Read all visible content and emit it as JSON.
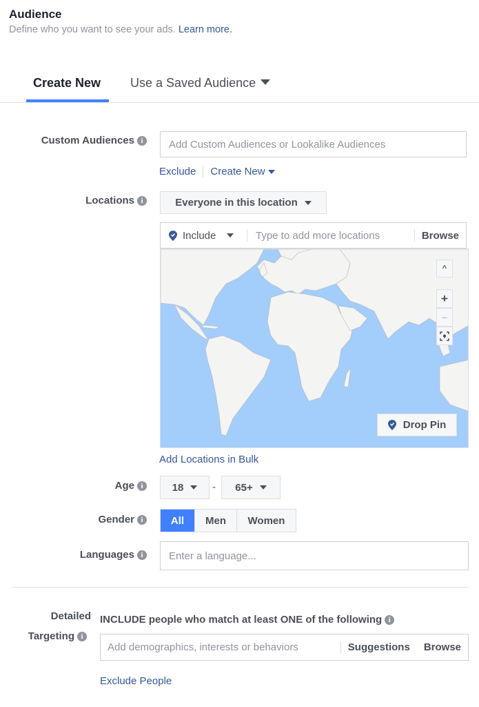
{
  "header": {
    "title": "Audience",
    "subtitle": "Define who you want to see your ads.",
    "learn_more": "Learn more."
  },
  "tabs": [
    {
      "label": "Create New",
      "active": true
    },
    {
      "label": "Use a Saved Audience",
      "active": false
    }
  ],
  "custom_audiences": {
    "label": "Custom Audiences",
    "placeholder": "Add Custom Audiences or Lookalike Audiences",
    "exclude_link": "Exclude",
    "create_new_link": "Create New"
  },
  "locations": {
    "label": "Locations",
    "dropdown_value": "Everyone in this location",
    "include_value": "Include",
    "placeholder": "Type to add more locations",
    "browse_label": "Browse",
    "map_controls": {
      "up": "^",
      "zoom_in": "+",
      "zoom_out": "−"
    },
    "drop_pin_label": "Drop Pin",
    "bulk_link": "Add Locations in Bulk"
  },
  "age": {
    "label": "Age",
    "min": "18",
    "separator": "-",
    "max": "65+"
  },
  "gender": {
    "label": "Gender",
    "options": [
      {
        "label": "All",
        "selected": true
      },
      {
        "label": "Men",
        "selected": false
      },
      {
        "label": "Women",
        "selected": false
      }
    ]
  },
  "languages": {
    "label": "Languages",
    "placeholder": "Enter a language..."
  },
  "detailed_targeting": {
    "label_line1": "Detailed",
    "label_line2": "Targeting",
    "include_text": "INCLUDE people who match at least ONE of the following",
    "placeholder": "Add demographics, interests or behaviors",
    "suggestions_label": "Suggestions",
    "browse_label": "Browse",
    "exclude_link": "Exclude People"
  },
  "colors": {
    "accent": "#4080ff",
    "link": "#365899",
    "map_water": "#a3cdfb",
    "map_land": "#f4f4f2"
  }
}
